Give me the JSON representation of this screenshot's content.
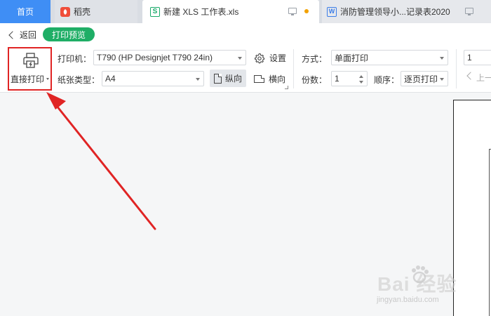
{
  "tabs": [
    {
      "label": "首页"
    },
    {
      "label": "稻壳"
    },
    {
      "label": "新建 XLS 工作表.xls"
    },
    {
      "label": "消防管理领导小...记录表2020"
    }
  ],
  "toolbar": {
    "back_label": "返回",
    "mode_badge": "打印预览",
    "direct_print_label": "直接打印",
    "printer_label": "打印机：",
    "printer_value": "T790 (HP Designjet T790 24in)",
    "settings_label": "设置",
    "paper_label": "纸张类型：",
    "paper_value": "A4",
    "portrait_label": "纵向",
    "landscape_label": "横向",
    "method_label": "方式：",
    "method_value": "单面打印",
    "copies_label": "份数：",
    "copies_value": "1",
    "order_label": "顺序：",
    "order_value": "逐页打印",
    "page_value": "1",
    "prev_label": "上一"
  },
  "watermark": {
    "text": "Bai 经验",
    "sub": "jingyan.baidu.com"
  },
  "colors": {
    "home_tab": "#3f8ef5",
    "badge": "#1fae66",
    "highlight_box": "#e02424",
    "arrow": "#e02424"
  }
}
